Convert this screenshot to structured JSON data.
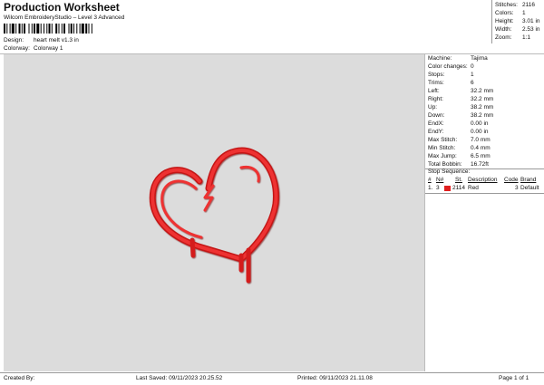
{
  "header": {
    "title": "Production Worksheet",
    "subtitle": "Wilcom EmbroideryStudio – Level 3 Advanced",
    "design_label": "Design:",
    "design_value": "heart melt v1.3 in",
    "colorway_label": "Colorway:",
    "colorway_value": "Colorway 1"
  },
  "stats": [
    {
      "label": "Stitches:",
      "value": "2116"
    },
    {
      "label": "Colors:",
      "value": "1"
    },
    {
      "label": "Height:",
      "value": "3.01 in"
    },
    {
      "label": "Width:",
      "value": "2.53 in"
    },
    {
      "label": "Zoom:",
      "value": "1:1"
    }
  ],
  "machine_info": [
    {
      "label": "Machine:",
      "value": "Tajima"
    },
    {
      "label": "Color changes:",
      "value": "0"
    },
    {
      "label": "Stops:",
      "value": "1"
    },
    {
      "label": "Trims:",
      "value": "6"
    },
    {
      "label": "Left:",
      "value": "32.2 mm"
    },
    {
      "label": "Right:",
      "value": "32.2 mm"
    },
    {
      "label": "Up:",
      "value": "38.2 mm"
    },
    {
      "label": "Down:",
      "value": "38.2 mm"
    },
    {
      "label": "EndX:",
      "value": "0.00 in"
    },
    {
      "label": "EndY:",
      "value": "0.00 in"
    },
    {
      "label": "Max Stitch:",
      "value": "7.0 mm"
    },
    {
      "label": "Min Stitch:",
      "value": "0.4 mm"
    },
    {
      "label": "Max Jump:",
      "value": "6.5 mm"
    },
    {
      "label": "Total Bobbin:",
      "value": "16.72ft"
    }
  ],
  "stop_sequence": {
    "title": "Stop Sequence:",
    "headers": [
      "#",
      "N#",
      "St.",
      "Description",
      "Code",
      "Brand"
    ],
    "rows": [
      {
        "num": "1.",
        "needle": "3",
        "color": "#e02020",
        "stitches": "2114",
        "description": "Red",
        "code": "3",
        "brand": "Default"
      }
    ]
  },
  "footer": {
    "created_by": "Created By:",
    "last_saved": "Last Saved: 09/11/2023 20.25.52",
    "printed": "Printed: 09/11/2023 21.11.08",
    "page": "Page 1 of 1"
  },
  "colors": {
    "thread_red": "#e82020",
    "thread_dark": "#b01010",
    "canvas_bg": "#dcdcdc"
  }
}
